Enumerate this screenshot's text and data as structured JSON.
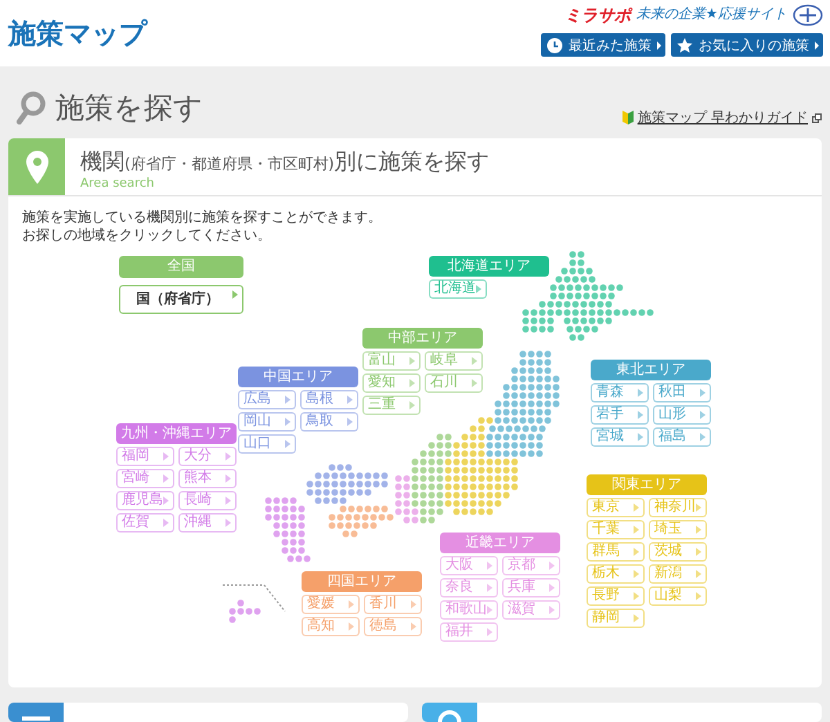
{
  "header": {
    "logo": "施策マップ",
    "brand": {
      "name": "ミラサポ",
      "tagline": "未来の企業★応援サイト"
    },
    "buttons": [
      {
        "label": "最近みた施策",
        "kind": "clock"
      },
      {
        "label": "お気に入りの施策",
        "kind": "star"
      }
    ]
  },
  "page_title": "施策を探す",
  "guide_link": "施策マップ 早わかりガイド",
  "section": {
    "title": "機関",
    "title_note": "(府省庁・都道府県・市区町村)",
    "title_end": "別に施策を探す",
    "subtitle": "Area search",
    "description": [
      "施策を実施している機関別に施策を探すことができます。",
      "お探しの地域をクリックしてください。"
    ]
  },
  "areas": [
    {
      "name": "全国",
      "kind": "national",
      "color": "#8cc86e",
      "prefectures": [
        "国（府省庁）"
      ]
    },
    {
      "name": "北海道エリア",
      "kind": "region",
      "color": "#1fbf8f",
      "prefectures": [
        "北海道"
      ]
    },
    {
      "name": "中部エリア",
      "kind": "region",
      "color": "#8cc86e",
      "prefectures": [
        "富山",
        "岐阜",
        "愛知",
        "石川",
        "三重"
      ]
    },
    {
      "name": "中国エリア",
      "kind": "region",
      "color": "#7b93e0",
      "prefectures": [
        "広島",
        "島根",
        "岡山",
        "鳥取",
        "山口"
      ]
    },
    {
      "name": "東北エリア",
      "kind": "region",
      "color": "#4aa9cb",
      "prefectures": [
        "青森",
        "秋田",
        "岩手",
        "山形",
        "宮城",
        "福島"
      ]
    },
    {
      "name": "九州・沖縄エリア",
      "kind": "region",
      "color": "#d27be8",
      "prefectures": [
        "福岡",
        "大分",
        "宮崎",
        "熊本",
        "鹿児島",
        "長崎",
        "佐賀",
        "沖縄"
      ]
    },
    {
      "name": "関東エリア",
      "kind": "region",
      "color": "#e6c318",
      "prefectures": [
        "東京",
        "神奈川",
        "千葉",
        "埼玉",
        "群馬",
        "茨城",
        "栃木",
        "新潟",
        "長野",
        "山梨",
        "静岡"
      ]
    },
    {
      "name": "四国エリア",
      "kind": "region",
      "color": "#f5a06a",
      "prefectures": [
        "愛媛",
        "香川",
        "高知",
        "徳島"
      ]
    },
    {
      "name": "近畿エリア",
      "kind": "region",
      "color": "#e48fe2",
      "prefectures": [
        "大阪",
        "京都",
        "奈良",
        "兵庫",
        "和歌山",
        "滋賀",
        "福井"
      ]
    }
  ]
}
